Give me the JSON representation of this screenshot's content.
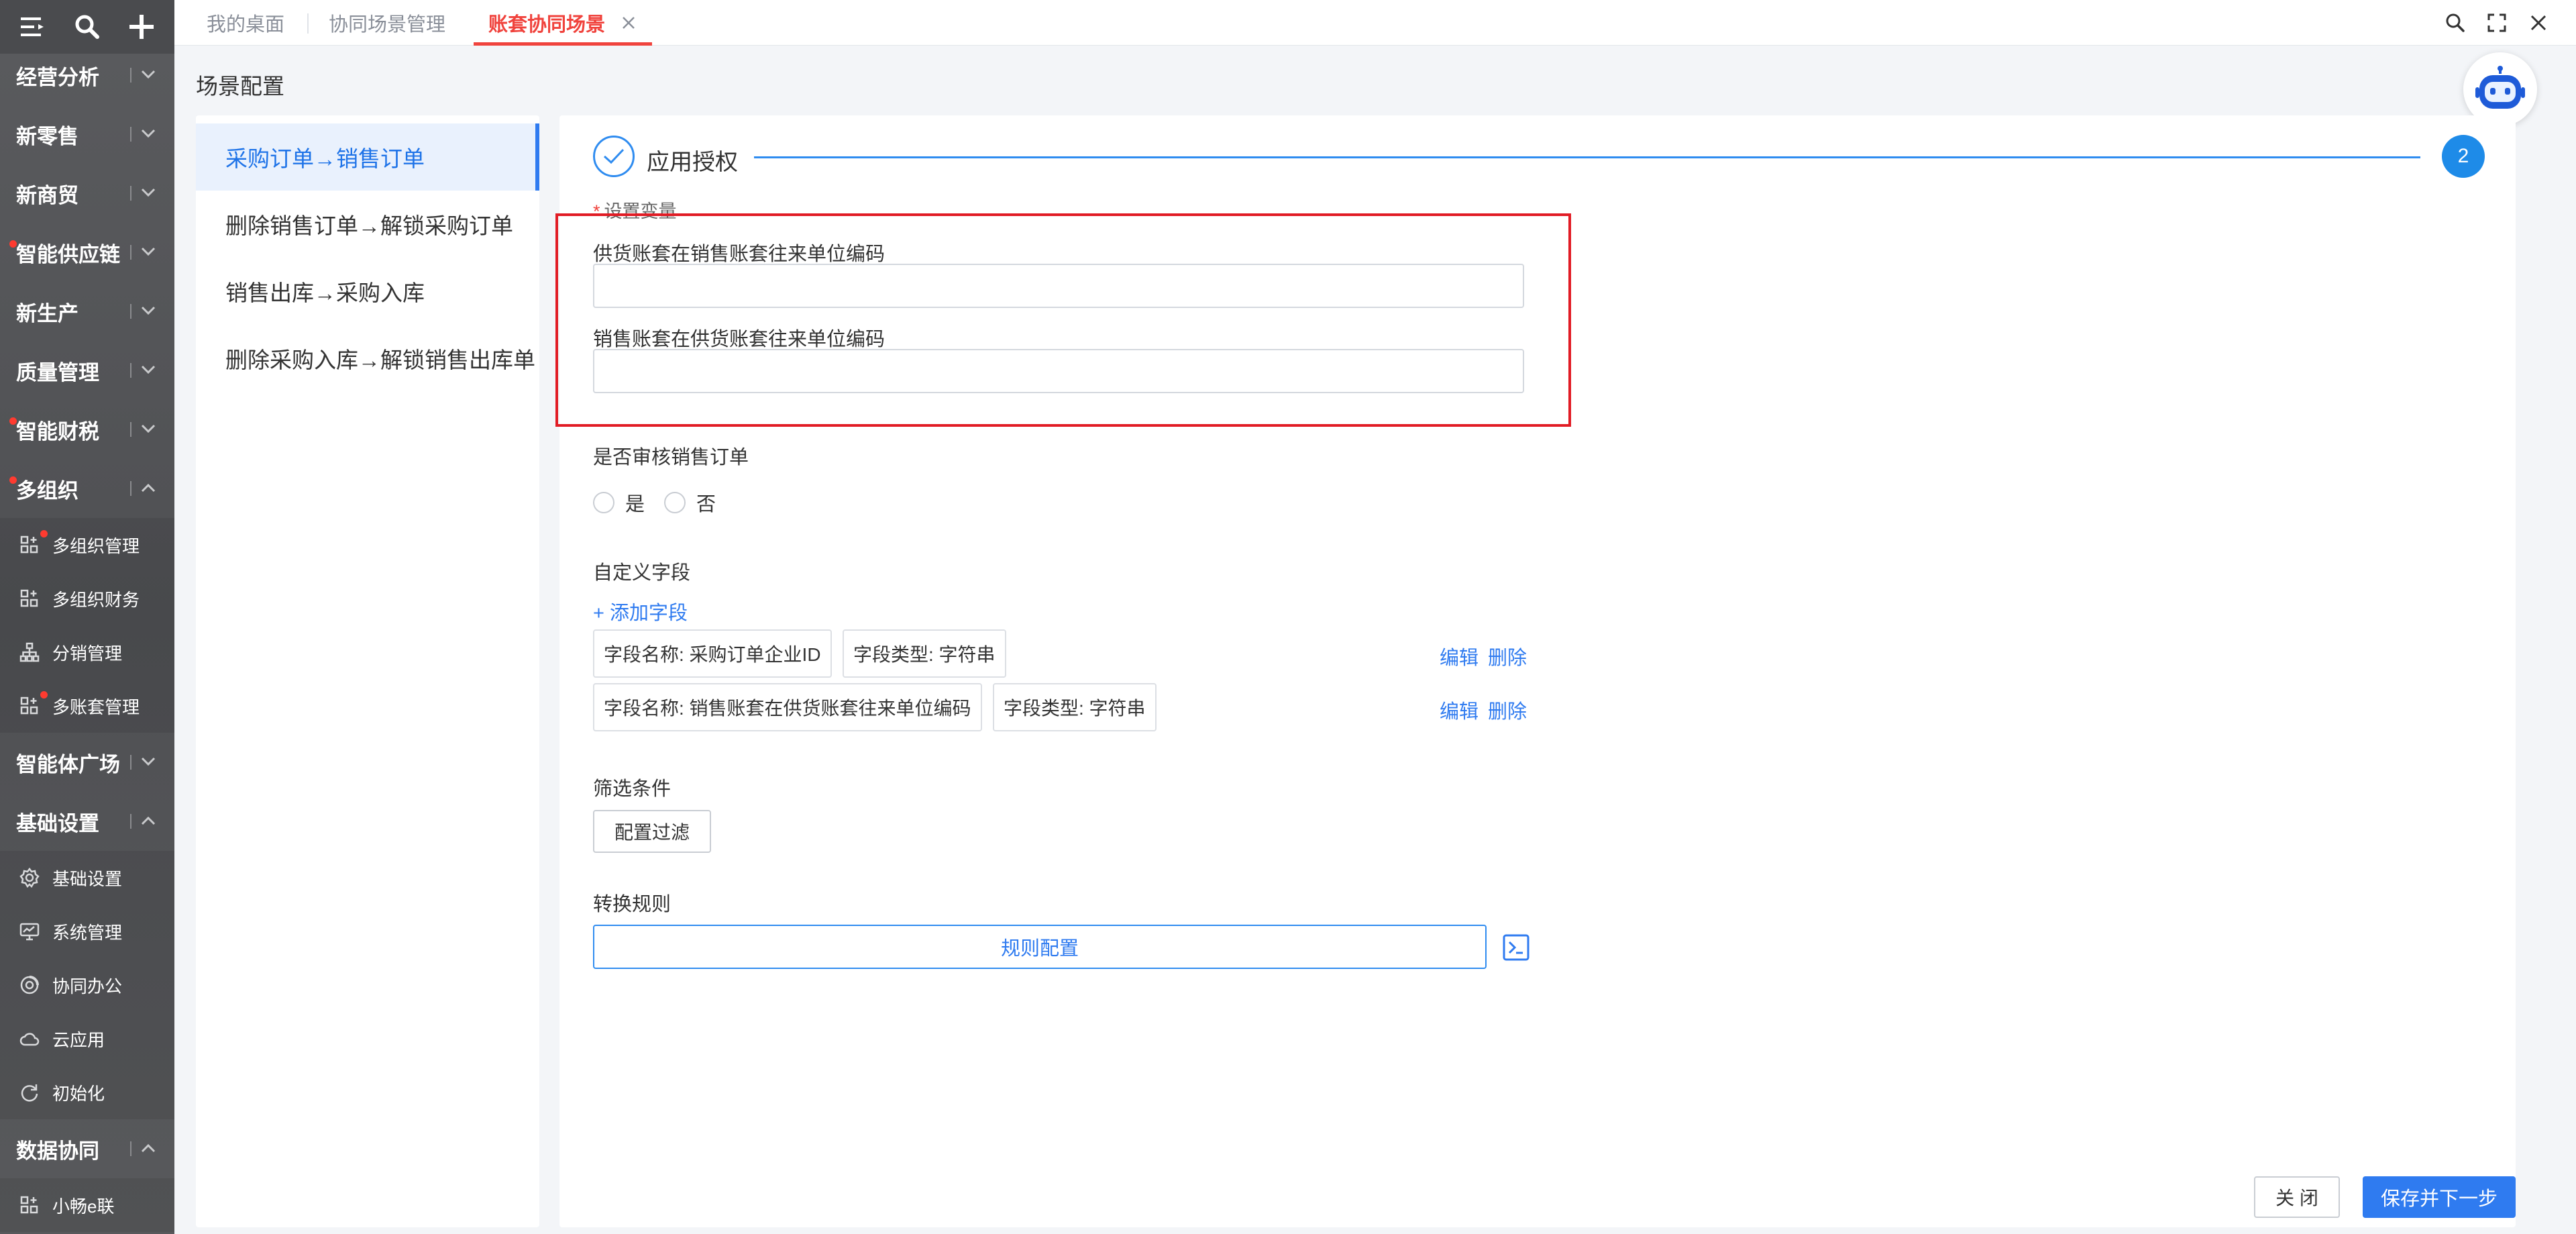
{
  "colors": {
    "accent": "#2f7bf0",
    "active_tab": "#f0433d",
    "highlight": "#e11c25",
    "sidebar_bg": "#55565a",
    "badge": "#ff3b30"
  },
  "sidebar": {
    "top_icons": [
      "menu-icon",
      "search-icon",
      "plus-icon"
    ],
    "groups": [
      {
        "label": "经营分析",
        "expanded": false,
        "dot": false
      },
      {
        "label": "新零售",
        "expanded": false,
        "dot": false
      },
      {
        "label": "新商贸",
        "expanded": false,
        "dot": false
      },
      {
        "label": "智能供应链",
        "expanded": false,
        "dot": true
      },
      {
        "label": "新生产",
        "expanded": false,
        "dot": false
      },
      {
        "label": "质量管理",
        "expanded": false,
        "dot": false
      },
      {
        "label": "智能财税",
        "expanded": false,
        "dot": true
      },
      {
        "label": "多组织",
        "expanded": true,
        "dot": true,
        "items": [
          {
            "label": "多组织管理",
            "icon": "module-icon",
            "dot": true
          },
          {
            "label": "多组织财务",
            "icon": "module-icon",
            "dot": false
          },
          {
            "label": "分销管理",
            "icon": "org-tree-icon",
            "dot": false
          },
          {
            "label": "多账套管理",
            "icon": "module-icon",
            "dot": true
          }
        ]
      },
      {
        "label": "智能体广场",
        "expanded": false,
        "dot": false
      },
      {
        "label": "基础设置",
        "expanded": true,
        "dot": false,
        "items": [
          {
            "label": "基础设置",
            "icon": "gear-icon",
            "dot": false
          },
          {
            "label": "系统管理",
            "icon": "monitor-icon",
            "dot": false
          },
          {
            "label": "协同办公",
            "icon": "collab-icon",
            "dot": false
          },
          {
            "label": "云应用",
            "icon": "cloud-icon",
            "dot": false
          },
          {
            "label": "初始化",
            "icon": "reset-icon",
            "dot": false
          }
        ]
      },
      {
        "label": "数据协同",
        "expanded": true,
        "dot": false,
        "items": [
          {
            "label": "小畅e联",
            "icon": "module-icon",
            "dot": false
          }
        ]
      }
    ]
  },
  "tabs": [
    {
      "label": "我的桌面",
      "active": false
    },
    {
      "label": "协同场景管理",
      "active": false
    },
    {
      "label": "账套协同场景",
      "active": true,
      "closable": true
    }
  ],
  "window_controls": [
    "search-icon",
    "fullscreen-icon",
    "close-icon"
  ],
  "page": {
    "title": "场景配置"
  },
  "scenarios": [
    {
      "label": "采购订单→销售订单",
      "active": true
    },
    {
      "label": "删除销售订单→解锁采购订单",
      "active": false
    },
    {
      "label": "销售出库→采购入库",
      "active": false
    },
    {
      "label": "删除采购入库→解锁销售出库单",
      "active": false
    }
  ],
  "steps": {
    "step1_label": "应用授权",
    "step2_number": "2"
  },
  "variables": {
    "section_label": "设置变量",
    "required_mark": "*",
    "field1_label": "供货账套在销售账套往来单位编码",
    "field1_value": "",
    "field2_label": "销售账套在供货账套往来单位编码",
    "field2_value": ""
  },
  "audit": {
    "label": "是否审核销售订单",
    "options": [
      "是",
      "否"
    ],
    "selected": ""
  },
  "custom_fields": {
    "label": "自定义字段",
    "add_label": "+ 添加字段",
    "rows": [
      {
        "name": "字段名称: 采购订单企业ID",
        "type": "字段类型: 字符串",
        "edit": "编辑",
        "delete": "删除"
      },
      {
        "name": "字段名称: 销售账套在供货账套往来单位编码",
        "type": "字段类型: 字符串",
        "edit": "编辑",
        "delete": "删除"
      }
    ]
  },
  "filter": {
    "label": "筛选条件",
    "button": "配置过滤"
  },
  "transform": {
    "label": "转换规则",
    "button": "规则配置"
  },
  "footer": {
    "close": "关 闭",
    "next": "保存并下一步"
  }
}
